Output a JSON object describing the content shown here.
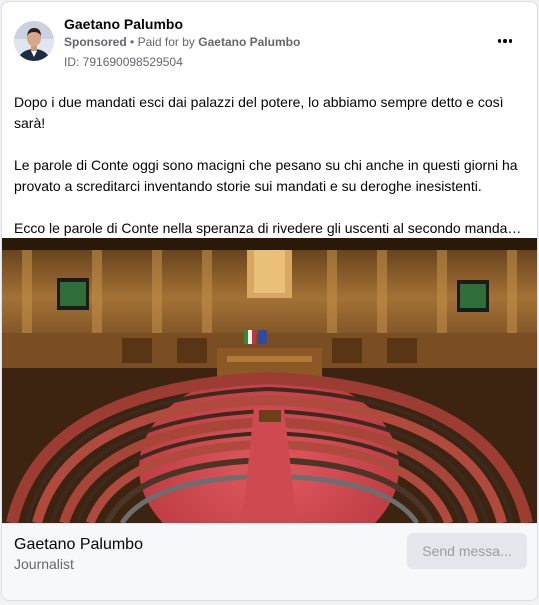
{
  "post": {
    "author": "Gaetano Palumbo",
    "sponsored": "Sponsored",
    "separator": "•",
    "paid_for_prefix": "Paid for by",
    "paid_for_name": "Gaetano Palumbo",
    "ad_id": "ID: 791690098529504",
    "paragraphs": [
      "Dopo i due mandati esci dai palazzi del potere, lo abbiamo sempre detto e così sarà!",
      "Le parole di Conte oggi sono macigni che pesano su chi anche in questi giorni ha provato a screditarci inventando storie sui mandati e su deroghe inesistenti.",
      "Ecco le parole di Conte nella speranza di rivedere gli uscenti al secondo mandato..."
    ],
    "image_icon": "senate-chamber-photo",
    "more_icon": "more-horizontal-icon"
  },
  "footer": {
    "name": "Gaetano Palumbo",
    "subtitle": "Journalist",
    "send_label": "Send messa..."
  },
  "colors": {
    "primary_text": "#050505",
    "secondary_text": "#65676b",
    "button_bg": "#e4e6eb",
    "button_text": "#9a9da1",
    "carpet": "#d2484f",
    "seats": "#b54a3e",
    "wood": "#8a5a2b"
  }
}
